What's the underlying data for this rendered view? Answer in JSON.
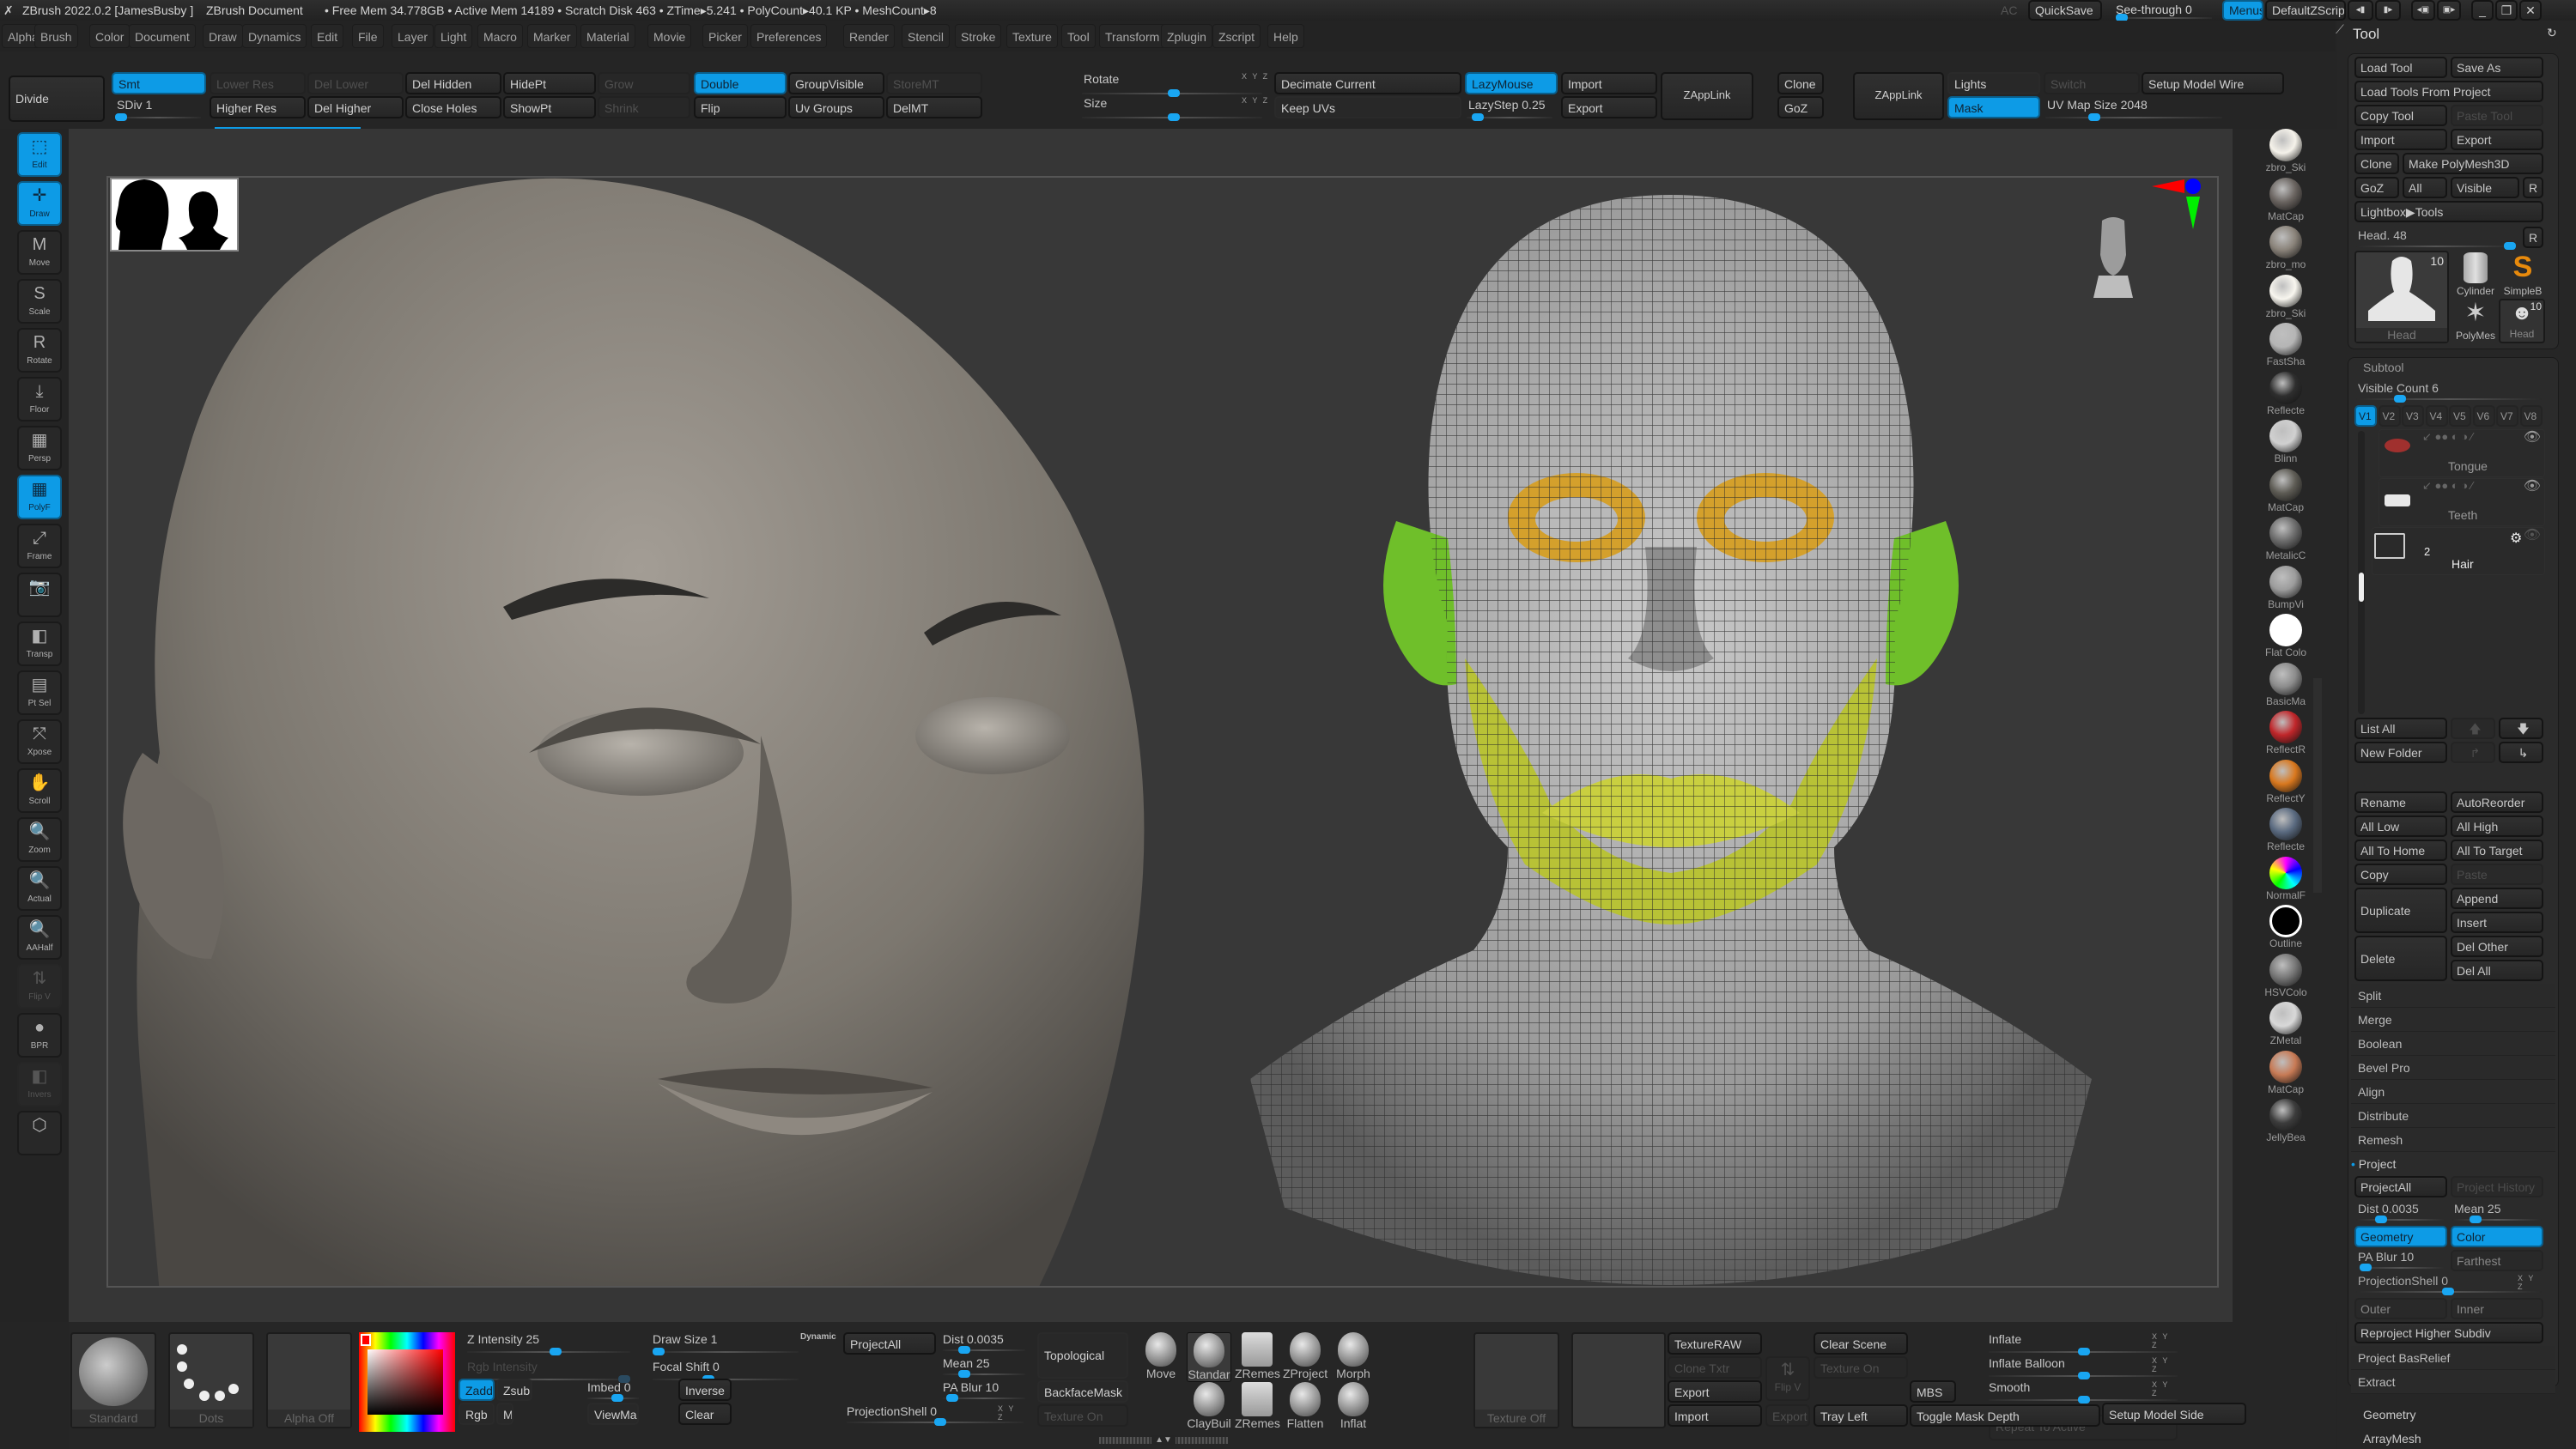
{
  "titlebar": {
    "app": "ZBrush 2022.0.2 [JamesBusby ]",
    "document": "ZBrush Document",
    "stats": "• Free Mem 34.778GB • Active Mem 14189 • Scratch Disk 463 • ZTime▸5.241 • PolyCount▸40.1 KP • MeshCount▸8",
    "ac": "AC",
    "quicksave": "QuickSave",
    "see_through": "See-through  0",
    "see_through_value": 0,
    "menus": "Menus",
    "default_zscript": "DefaultZScript"
  },
  "menubar": [
    "Alpha",
    "Brush",
    "Color",
    "Document",
    "Draw",
    "Dynamics",
    "Edit",
    "File",
    "Layer",
    "Light",
    "Macro",
    "Marker",
    "Material",
    "Movie",
    "Picker",
    "Preferences",
    "Render",
    "Stencil",
    "Stroke",
    "Texture",
    "Tool",
    "Transform",
    "Zplugin",
    "Zscript",
    "Help"
  ],
  "top_shelf": {
    "divide": "Divide",
    "smt": "Smt",
    "sdiv": "SDiv 1",
    "lower_res": "Lower Res",
    "higher_res": "Higher Res",
    "del_lower": "Del Lower",
    "del_higher": "Del Higher",
    "del_hidden": "Del Hidden",
    "close_holes": "Close Holes",
    "hidept": "HidePt",
    "showpt": "ShowPt",
    "grow": "Grow",
    "shrink": "Shrink",
    "double": "Double",
    "flip": "Flip",
    "group_visible": "GroupVisible",
    "uv_groups": "Uv Groups",
    "storemt": "StoreMT",
    "delmt": "DelMT",
    "rotate": "Rotate",
    "size": "Size",
    "decimate_current": "Decimate Current",
    "keep_uvs": "Keep UVs",
    "lazymouse": "LazyMouse",
    "lazystep": "LazyStep 0.25",
    "import": "Import",
    "export": "Export",
    "zapplink": "ZAppLink",
    "clone": "Clone",
    "goz": "GoZ",
    "zapplink2": "ZAppLink",
    "lights": "Lights",
    "switch": "Switch",
    "mask": "Mask",
    "setup_model_wire": "Setup Model Wire",
    "uv_map_size": "UV Map Size 2048",
    "xyz": "X Y Z"
  },
  "left_shelf": [
    {
      "label": "Edit",
      "icon": "edit-icon",
      "glyph": "⬚",
      "state": "on"
    },
    {
      "label": "Draw",
      "icon": "draw-icon",
      "glyph": "✛",
      "state": "on"
    },
    {
      "label": "Move",
      "icon": "move-icon",
      "glyph": "M",
      "state": "off"
    },
    {
      "label": "Scale",
      "icon": "scale-icon",
      "glyph": "S",
      "state": "off"
    },
    {
      "label": "Rotate",
      "icon": "rotate-icon",
      "glyph": "R",
      "state": "off"
    },
    {
      "label": "Floor",
      "icon": "floor-icon",
      "glyph": "⤓",
      "state": "off"
    },
    {
      "label": "Persp",
      "icon": "persp-icon",
      "glyph": "▦",
      "state": "off"
    },
    {
      "label": "PolyF",
      "icon": "polyframe-icon",
      "glyph": "▦",
      "state": "on"
    },
    {
      "label": "Frame",
      "icon": "frame-icon",
      "glyph": "⤢",
      "state": "off"
    },
    {
      "label": "",
      "icon": "camera-icon",
      "glyph": "📷",
      "state": "off"
    },
    {
      "label": "Transp",
      "icon": "transparency-icon",
      "glyph": "◧",
      "state": "off"
    },
    {
      "label": "Pt Sel",
      "icon": "point-select-icon",
      "glyph": "▤",
      "state": "off"
    },
    {
      "label": "Xpose",
      "icon": "xpose-icon",
      "glyph": "⤧",
      "state": "off"
    },
    {
      "label": "Scroll",
      "icon": "scroll-icon",
      "glyph": "✋",
      "state": "off"
    },
    {
      "label": "Zoom",
      "icon": "zoom-icon",
      "glyph": "🔍",
      "state": "off"
    },
    {
      "label": "Actual",
      "icon": "actual-icon",
      "glyph": "🔍",
      "state": "off"
    },
    {
      "label": "AAHalf",
      "icon": "aahalf-icon",
      "glyph": "🔍",
      "state": "off"
    },
    {
      "label": "Flip V",
      "icon": "flip-v-icon",
      "glyph": "⇅",
      "state": "dis"
    },
    {
      "label": "BPR",
      "icon": "bpr-icon",
      "glyph": "●",
      "state": "off"
    },
    {
      "label": "Invers",
      "icon": "invert-icon",
      "glyph": "◧",
      "state": "dis"
    },
    {
      "label": "",
      "icon": "cube-icon",
      "glyph": "⬡",
      "state": "off"
    }
  ],
  "materials": [
    {
      "label": "zbro_Ski",
      "color": "#f5f2ea"
    },
    {
      "label": "MatCap",
      "color": "#6a6460"
    },
    {
      "label": "zbro_mo",
      "color": "#8a837a"
    },
    {
      "label": "zbro_Ski",
      "color": "#f8f6ef"
    },
    {
      "label": "FastSha",
      "color": "#b5b5b5"
    },
    {
      "label": "Reflecte",
      "color": "#2e2e2e"
    },
    {
      "label": "Blinn",
      "color": "#d0d0d0"
    },
    {
      "label": "MatCap",
      "color": "#5e5c55"
    },
    {
      "label": "MetalicC",
      "color": "#6c6c6c"
    },
    {
      "label": "BumpVi",
      "color": "#9c9c9c"
    },
    {
      "label": "Flat Colo",
      "color": "#ffffff"
    },
    {
      "label": "BasicMa",
      "color": "#8c8c8c"
    },
    {
      "label": "ReflectR",
      "color": "#c0262a"
    },
    {
      "label": "ReflectY",
      "color": "#d9781e"
    },
    {
      "label": "Reflecte",
      "color": "#5a6a80"
    },
    {
      "label": "NormalF",
      "color": "#7b8be8"
    },
    {
      "label": "Outline",
      "color": "#000000"
    },
    {
      "label": "HSVColo",
      "color": "#777777"
    },
    {
      "label": "ZMetal",
      "color": "#d8d8d8"
    },
    {
      "label": "MatCap",
      "color": "#c77a55"
    },
    {
      "label": "JellyBea",
      "color": "#3c3c3c"
    }
  ],
  "tool_panel": {
    "title": "Tool",
    "load_tool": "Load Tool",
    "save_as": "Save As",
    "load_tools_from_project": "Load Tools From Project",
    "copy_tool": "Copy Tool",
    "paste_tool": "Paste Tool",
    "import": "Import",
    "export": "Export",
    "clone": "Clone",
    "make_polymesh3d": "Make PolyMesh3D",
    "goz": "GoZ",
    "all": "All",
    "visible": "Visible",
    "r": "R",
    "lightbox_tools": "Lightbox▶Tools",
    "head_slider": "Head. 48",
    "tools": [
      {
        "label": "Head",
        "count": "10"
      },
      {
        "label": "Cylinder"
      },
      {
        "label": "SimpleB"
      },
      {
        "label": "PolyMes"
      },
      {
        "label": "Head",
        "count": "10"
      }
    ]
  },
  "subtool": {
    "title": "Subtool",
    "visible_count": "Visible Count 6",
    "versions": [
      "V1",
      "V2",
      "V3",
      "V4",
      "V5",
      "V6",
      "V7",
      "V8"
    ],
    "active_version": "V1",
    "items": [
      {
        "name": "Tongue"
      },
      {
        "name": "Teeth"
      }
    ],
    "folder": {
      "name": "Hair",
      "count": "2"
    },
    "list_all": "List All",
    "new_folder": "New Folder",
    "rename": "Rename",
    "autoreorder": "AutoReorder",
    "all_low": "All Low",
    "all_high": "All High",
    "all_to_home": "All To Home",
    "all_to_target": "All To Target",
    "copy": "Copy",
    "paste": "Paste",
    "duplicate": "Duplicate",
    "append": "Append",
    "insert": "Insert",
    "delete": "Delete",
    "del_other": "Del Other",
    "del_all": "Del All",
    "sections": [
      "Split",
      "Merge",
      "Boolean",
      "Bevel Pro",
      "Align",
      "Distribute",
      "Remesh"
    ],
    "project": {
      "title": "Project",
      "project_all": "ProjectAll",
      "project_history": "Project History",
      "dist": "Dist 0.0035",
      "mean": "Mean 25",
      "geometry": "Geometry",
      "color": "Color",
      "pa_blur": "PA Blur 10",
      "farthest": "Farthest",
      "projection_shell": "ProjectionShell 0",
      "outer": "Outer",
      "inner": "Inner",
      "reproject": "Reproject Higher Subdiv"
    },
    "after": [
      "Project BasRelief",
      "Extract"
    ]
  },
  "below_panel": [
    "Geometry",
    "ArrayMesh"
  ],
  "bottom_shelf": {
    "brush": "Standard",
    "stroke": "Dots",
    "alpha": "Alpha Off",
    "z_intensity": "Z Intensity 25",
    "rgb_intensity": "Rgb Intensity",
    "draw_size": "Draw Size 1",
    "dynamic": "Dynamic",
    "focal_shift": "Focal Shift 0",
    "zadd": "Zadd",
    "zsub": "Zsub",
    "imbed": "Imbed 0",
    "inverse": "Inverse",
    "rgb": "Rgb",
    "m": "M",
    "viewmask": "ViewMask",
    "clear": "Clear",
    "project_all": "ProjectAll",
    "dist": "Dist 0.0035",
    "mean": "Mean 25",
    "pa_blur": "PA Blur 10",
    "projection_shell": "ProjectionShell 0",
    "topological": "Topological",
    "backface_mask": "BackfaceMask",
    "texture_on": "Texture On",
    "brushes": [
      "Move",
      "Standar",
      "ZRemes",
      "ZProject",
      "Morph",
      "ClayBuil",
      "ZRemes",
      "Flatten",
      "Inflat"
    ],
    "texture_off": "Texture Off",
    "texture_raw": "TextureRAW",
    "clone_txtr": "Clone Txtr",
    "export": "Export",
    "import": "Import",
    "flip_v": "Flip V",
    "export2": "Export",
    "clear_scene": "Clear Scene",
    "texture_on2": "Texture On",
    "mbs": "MBS",
    "tray_left": "Tray Left",
    "toggle_mask_depth": "Toggle Mask Depth",
    "repeat_to_active": "Repeat To Active",
    "setup_model_side": "Setup Model Side",
    "inflate": "Inflate",
    "inflate_balloon": "Inflate Balloon",
    "smooth": "Smooth",
    "xyz": "X Y Z"
  },
  "colors": {
    "accent": "#0d9be6",
    "mask_yellow": "#c7cc3a",
    "ear_green": "#7ccc2c",
    "eye_orange": "#d4a02c"
  }
}
